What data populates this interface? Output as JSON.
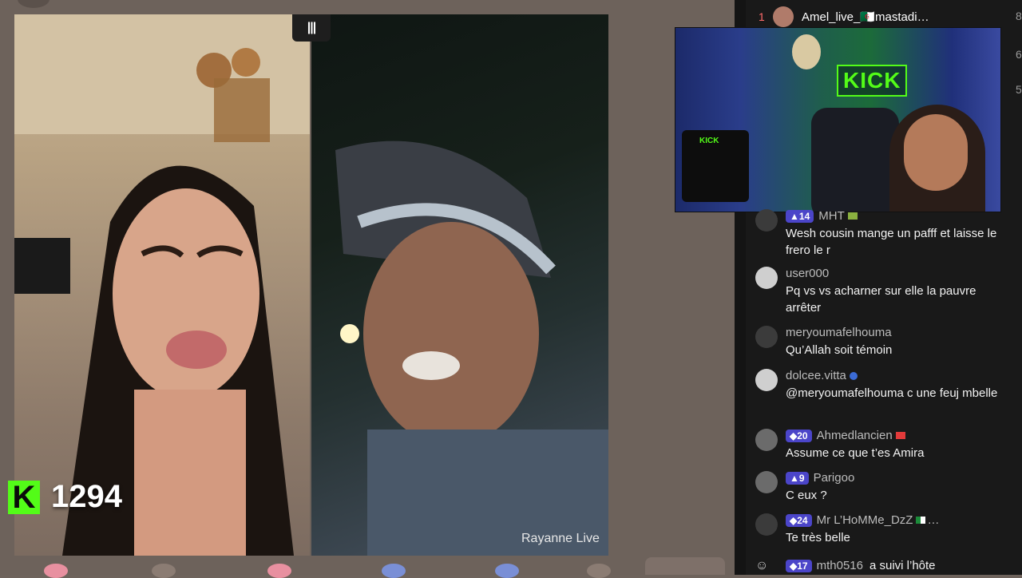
{
  "stream": {
    "left_label": "",
    "right_watermark": "Rayanne Live",
    "split_icon": "split-view-icon",
    "kick_count": "1294",
    "kick_logo": "K"
  },
  "leaderboard": {
    "rank": "1",
    "name": "Amel_live_🇩🇿mastadi…",
    "side_numbers": [
      "8",
      "6",
      "5"
    ]
  },
  "cam": {
    "sign": "KICK",
    "shirt": "KICK"
  },
  "chat": [
    {
      "level": "14",
      "name": "MHT",
      "text": "Wesh cousin mange un pafff et laisse le frero le r",
      "flag": "green"
    },
    {
      "level": "",
      "name": "user000",
      "text": "Pq vs vs acharner sur elle la pauvre arrêter",
      "flag": ""
    },
    {
      "level": "",
      "name": "meryoumafelhouma",
      "text": "Qu’Allah soit témoin",
      "flag": ""
    },
    {
      "level": "",
      "name": "dolcee.vitta",
      "text": "@meryoumafelhouma c une feuj mbelle",
      "flag": "blue"
    },
    {
      "level": "20",
      "name": "Ahmedlancien",
      "text": "Assume ce que t’es Amira",
      "flag": "red"
    },
    {
      "level": "9",
      "name": "Parigoo",
      "text": "C eux ?",
      "flag": ""
    },
    {
      "level": "24",
      "name": "Mr L’HoMMe_DzZ",
      "text": "Te très belle",
      "flag": "dz"
    }
  ],
  "follow": {
    "level": "17",
    "name": "mth0516",
    "action": "a suivi l’hôte"
  }
}
